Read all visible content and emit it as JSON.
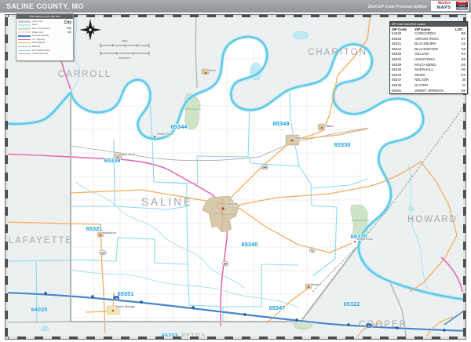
{
  "header": {
    "title": "SALINE COUNTY, MO",
    "edition": "2024 ZIP Code Premium Edition",
    "logo": {
      "market": "Market",
      "maps": "MAPS",
      "side_lines": [
        "SHOP",
        "MAPS",
        ".com"
      ]
    }
  },
  "legend": {
    "title": "2024 Saline County, MO Map",
    "area_rows": [
      {
        "label": "Urban Area",
        "color": "#c9cdcf"
      },
      {
        "label": "Water",
        "color": "#bfe9f5"
      },
      {
        "label": "Park / Conservation",
        "color": "#cfe3c8"
      },
      {
        "label": "Military Area",
        "color": "#e8e0d0"
      }
    ],
    "line_rows": [
      {
        "label": "Interstate Highway",
        "color": "#4a86c8"
      },
      {
        "label": "U.S. Highway",
        "color": "#e161ae"
      },
      {
        "label": "State Highway",
        "color": "#f2ad62"
      },
      {
        "label": "Railroad",
        "color": "#9aa0a2"
      },
      {
        "label": "ZIP Code Boundary",
        "color": "#86d9f2"
      },
      {
        "label": "County Boundary",
        "color": "#aaadad"
      }
    ],
    "city_rows": [
      "City",
      "City",
      "City"
    ]
  },
  "scale": {
    "miles": "Miles",
    "kilometers": "Kilometers"
  },
  "zip_table": {
    "title": "ZIP Code Index/Grid Locator",
    "columns": [
      "ZIP Code",
      "ZIP Name",
      "LOC"
    ],
    "rows": [
      {
        "zip": "64020",
        "name": "CONCORDIA",
        "loc": "B8"
      },
      {
        "zip": "65320",
        "name": "ARROW ROCK",
        "loc": "K7"
      },
      {
        "zip": "65321",
        "name": "BLACKBURN",
        "loc": "C6"
      },
      {
        "zip": "65322",
        "name": "BLACKWATER",
        "loc": "K8"
      },
      {
        "zip": "65330",
        "name": "GILLIAM",
        "loc": "K4"
      },
      {
        "zip": "65333",
        "name": "HOUSTONIA",
        "loc": "E9"
      },
      {
        "zip": "65339",
        "name": "MALTA BEND",
        "loc": "E5"
      },
      {
        "zip": "65340",
        "name": "MARSHALL",
        "loc": "H6"
      },
      {
        "zip": "65344",
        "name": "MIAMI",
        "loc": "G2"
      },
      {
        "zip": "65347",
        "name": "NELSON",
        "loc": "J8"
      },
      {
        "zip": "65349",
        "name": "SLATER",
        "loc": "J4"
      },
      {
        "zip": "65351",
        "name": "SWEET SPRINGS",
        "loc": "D8"
      }
    ]
  },
  "map": {
    "counties": [
      "CHARITON",
      "CARROLL",
      "LAFAYETTE",
      "SALINE",
      "HOWARD",
      "COOPER",
      "PETTIS"
    ],
    "zips": [
      "65344",
      "65349",
      "65330",
      "65339",
      "65321",
      "65340",
      "65320",
      "65351",
      "65347",
      "65322",
      "64020",
      "65333"
    ],
    "towns": [
      "Marshall",
      "Slater",
      "Gilliam",
      "Miami",
      "Malta Bend",
      "Grand Pass",
      "Sweet Springs",
      "Blackburn",
      "Nelson",
      "Arrow Rock"
    ],
    "areas": [
      "Grand Pass C.A.",
      "Arrow Rock S.H.S."
    ],
    "shields": [
      "70",
      "70",
      "65",
      "41",
      "240",
      "127"
    ],
    "colors": {
      "county_fill": "#ffffff",
      "outside_fill": "#edf0f0",
      "river": "#5ec9e9",
      "zip_boundary": "#86d9f2",
      "county_boundary": "#aaadad",
      "interstate": "#4a86c8",
      "us_highway": "#e161ae",
      "state_highway": "#f2ad62",
      "zip_label": "#1e9ddf",
      "urban": "#d8c8ac",
      "park": "#cfe4c6"
    }
  }
}
